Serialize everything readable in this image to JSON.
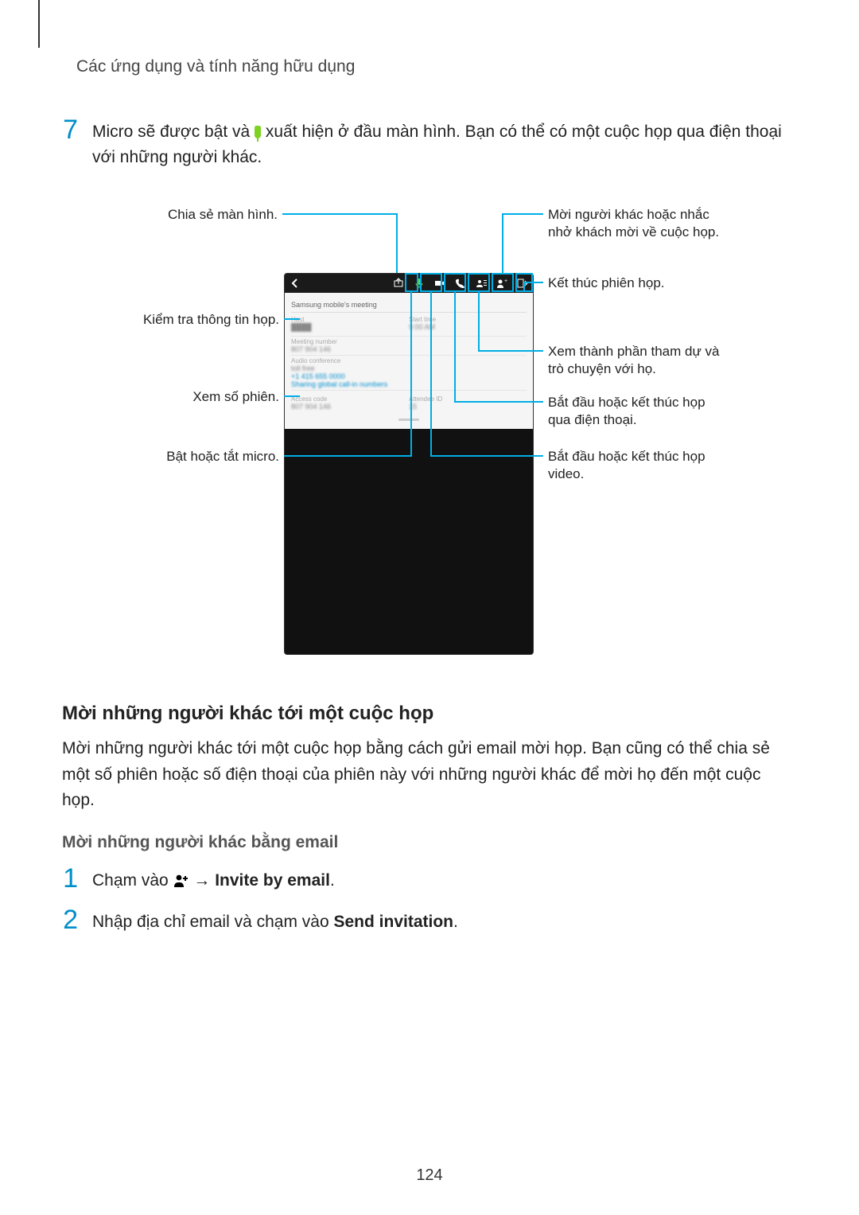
{
  "header": {
    "title": "Các ứng dụng và tính năng hữu dụng"
  },
  "step7": {
    "num": "7",
    "text_before_icon": "Micro sẽ được bật và ",
    "text_after_icon": " xuất hiện ở đầu màn hình. Bạn có thể có một cuộc họp qua điện thoại với những người khác."
  },
  "labels": {
    "share_screen": "Chia sẻ màn hình.",
    "invite": "Mời người khác hoặc nhắc nhở khách mời về cuộc họp.",
    "end_session": "Kết thúc phiên họp.",
    "check_info": "Kiểm tra thông tin họp.",
    "attendees": "Xem thành phần tham dự và trò chuyện với họ.",
    "view_session": "Xem số phiên.",
    "audio": "Bắt đầu hoặc kết thúc họp qua điện thoại.",
    "mic_toggle": "Bật hoặc tắt micro.",
    "video": "Bắt đầu hoặc kết thúc họp video."
  },
  "panel": {
    "title": "Samsung mobile's meeting",
    "host_label": "Host",
    "host_val": "████",
    "starts_label": "Start time",
    "starts_val": "9:00 AM",
    "meeting_num_label": "Meeting number",
    "meeting_num_val": "807 904 146",
    "audio_conf_label": "Audio conference",
    "audio_conf_val": "toll free",
    "toll_link": "+1 415 655 0000",
    "sharing_link": "Sharing global call-in numbers",
    "access_label": "Access code",
    "access_val": "807 904 146",
    "attendee_id_label": "Attendee ID",
    "attendee_id_val": "15"
  },
  "section": {
    "heading": "Mời những người khác tới một cuộc họp",
    "para": "Mời những người khác tới một cuộc họp bằng cách gửi email mời họp. Bạn cũng có thể chia sẻ một số phiên hoặc số điện thoại của phiên này với những người khác để mời họ đến một cuộc họp.",
    "sub_heading": "Mời những người khác bằng email"
  },
  "invite_step1": {
    "num": "1",
    "before": "Chạm vào ",
    "arrow": " → ",
    "bold": "Invite by email",
    "after": "."
  },
  "invite_step2": {
    "num": "2",
    "before": "Nhập địa chỉ email và chạm vào ",
    "bold": "Send invitation",
    "after": "."
  },
  "page_number": "124"
}
